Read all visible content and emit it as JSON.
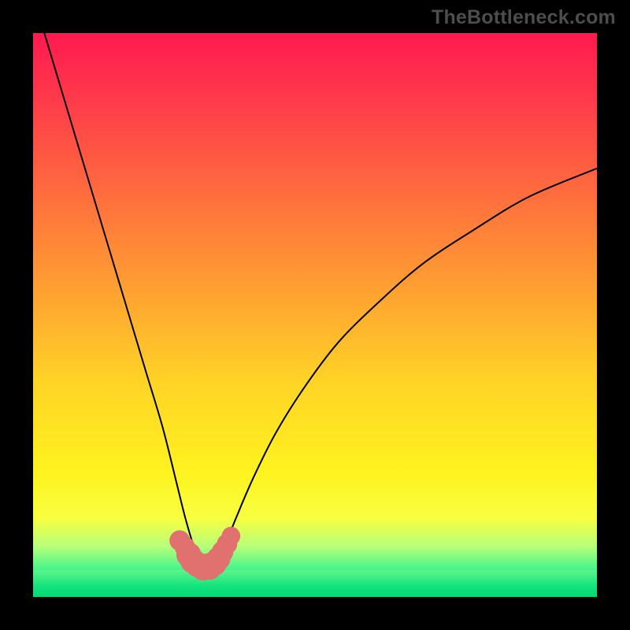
{
  "watermark": "TheBottleneck.com",
  "plot": {
    "gradient_css": "linear-gradient(to bottom, #ff1950 0%, #ff3b4a 12%, #ff6b3e 28%, #ffa231 46%, #ffd426 62%, #fff31f 78%, #f7ff40 86%, #b8ff7a 91%, #48f58a 95%, #00e57c 100%)",
    "green_band": {
      "top_pct": 95.2,
      "height_pct": 4.8,
      "gradient_css": "linear-gradient(to bottom, #5cf58c 0%, #14e37c 60%, #00da78 100%)"
    }
  },
  "chart_data": {
    "type": "line",
    "title": "",
    "xlabel": "",
    "ylabel": "",
    "xlim": [
      0,
      100
    ],
    "ylim": [
      0,
      100
    ],
    "note": "Two black curves descending from near the top edge into a trough at roughly x≈30, y≈5, then the right curve rises toward x=100, y≈75. Axes are unlabeled; values are visual estimates on a 0–100 normalized plot grid.",
    "series": [
      {
        "name": "left-curve",
        "x": [
          2,
          5,
          8,
          11,
          14,
          17,
          20,
          23,
          25.5,
          27,
          28.5,
          30
        ],
        "y": [
          100,
          90,
          80,
          70,
          60,
          50,
          40,
          30,
          20,
          14,
          9,
          5.5
        ]
      },
      {
        "name": "right-curve",
        "x": [
          32.5,
          34,
          36,
          39,
          43,
          48,
          54,
          61,
          69,
          78,
          88,
          100
        ],
        "y": [
          5.5,
          9,
          14,
          21,
          29,
          37,
          45,
          52,
          59,
          65,
          71,
          76
        ]
      }
    ],
    "markers": {
      "name": "trough-highlight",
      "color": "#e1716e",
      "points": [
        {
          "x": 26.0,
          "y": 10.0,
          "r": 3.3
        },
        {
          "x": 26.9,
          "y": 8.9,
          "r": 3.3
        },
        {
          "x": 27.6,
          "y": 7.5,
          "r": 4.0
        },
        {
          "x": 28.3,
          "y": 6.4,
          "r": 4.0
        },
        {
          "x": 29.2,
          "y": 5.7,
          "r": 4.0
        },
        {
          "x": 30.2,
          "y": 5.3,
          "r": 4.3
        },
        {
          "x": 31.2,
          "y": 5.4,
          "r": 4.3
        },
        {
          "x": 32.1,
          "y": 5.9,
          "r": 4.0
        },
        {
          "x": 32.9,
          "y": 6.8,
          "r": 3.8
        },
        {
          "x": 33.6,
          "y": 8.0,
          "r": 3.5
        },
        {
          "x": 34.4,
          "y": 9.4,
          "r": 3.3
        },
        {
          "x": 35.1,
          "y": 10.8,
          "r": 3.0
        }
      ]
    }
  }
}
